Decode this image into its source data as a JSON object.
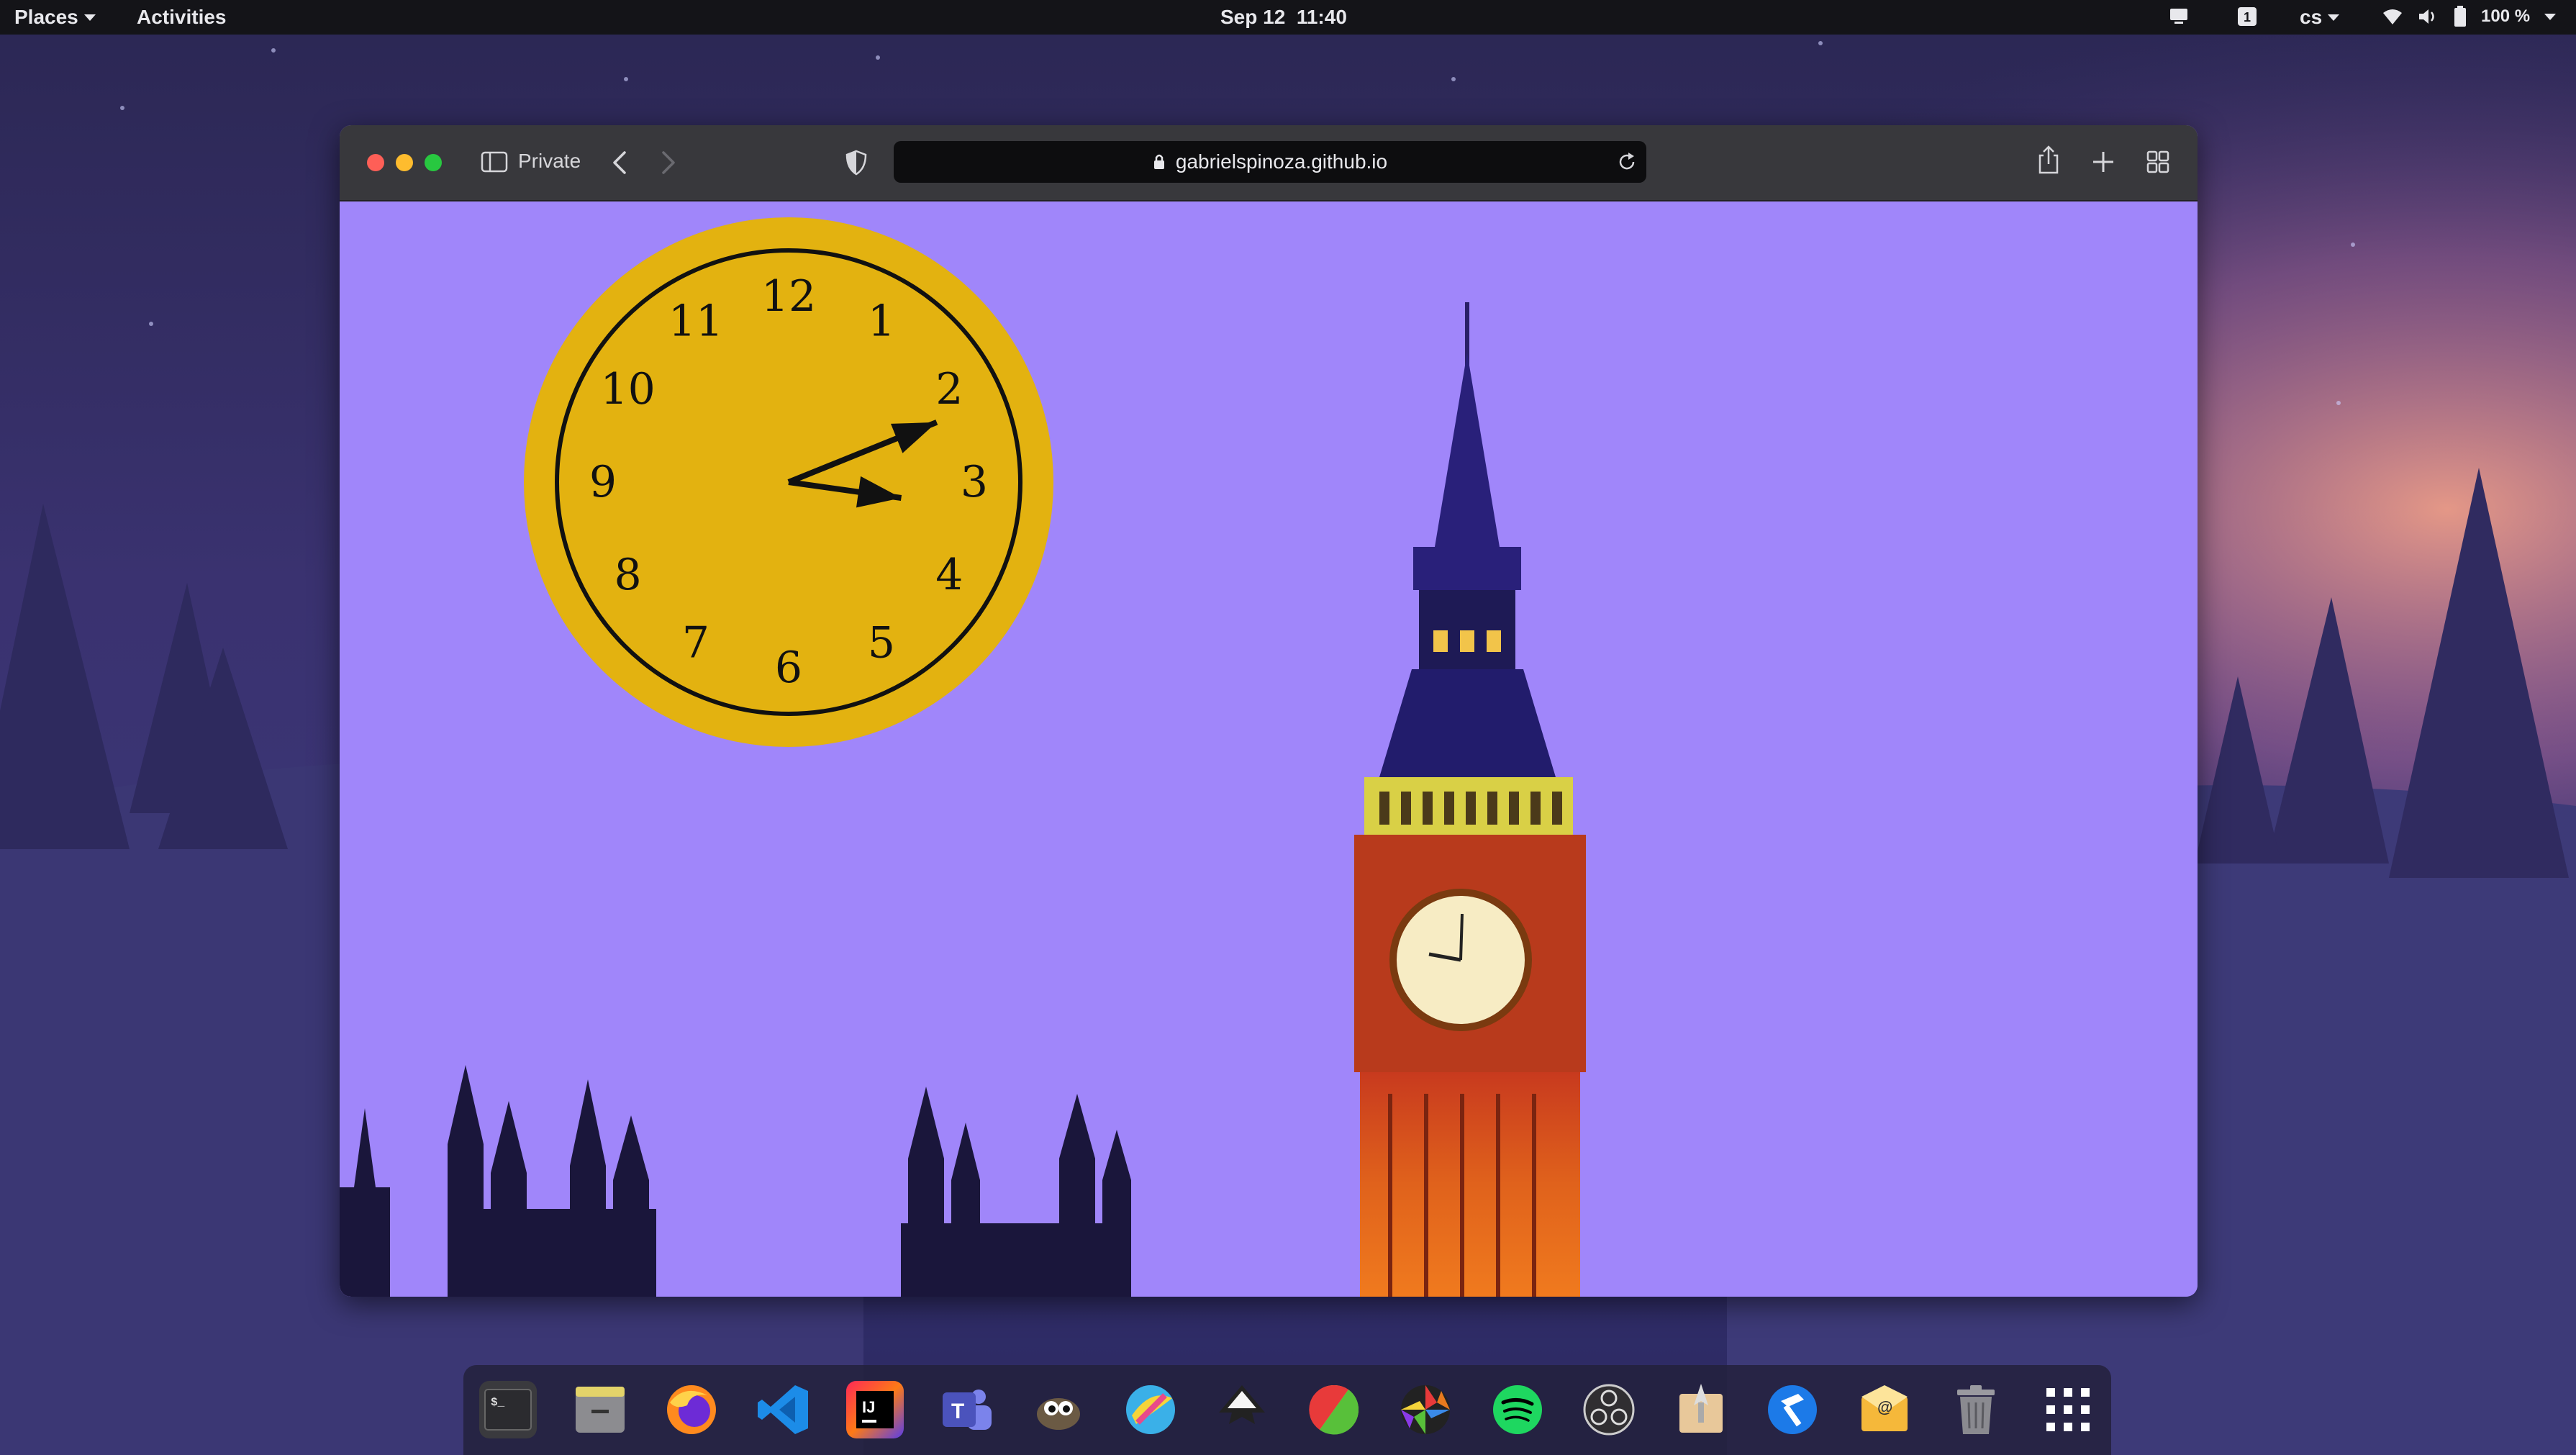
{
  "topbar": {
    "places_label": "Places",
    "activities_label": "Activities",
    "datetime": "Sep 12  11:40",
    "lang": "cs",
    "battery": "100 %"
  },
  "browser": {
    "mode_label": "Private",
    "url": "gabrielspinoza.github.io"
  },
  "clock": {
    "numbers": [
      "12",
      "1",
      "2",
      "3",
      "4",
      "5",
      "6",
      "7",
      "8",
      "9",
      "10",
      "11"
    ],
    "face_color": "#e3b210",
    "hour_hand_deg": 98,
    "minute_hand_deg": 68
  },
  "dock": {
    "items": [
      {
        "name": "terminal-icon"
      },
      {
        "name": "files-icon"
      },
      {
        "name": "firefox-icon"
      },
      {
        "name": "vscode-icon"
      },
      {
        "name": "intellij-icon",
        "text": "IJ"
      },
      {
        "name": "teams-icon",
        "text": "T"
      },
      {
        "name": "gimp-icon"
      },
      {
        "name": "krita-icon"
      },
      {
        "name": "inkscape-icon"
      },
      {
        "name": "color-picker-icon"
      },
      {
        "name": "aperture-icon"
      },
      {
        "name": "spotify-icon"
      },
      {
        "name": "obs-icon"
      },
      {
        "name": "launcher-icon"
      },
      {
        "name": "build-tool-icon"
      },
      {
        "name": "mail-icon",
        "text": "@"
      },
      {
        "name": "trash-icon"
      },
      {
        "name": "app-grid-icon"
      }
    ]
  },
  "colors": {
    "accent": "#e3b210",
    "sky": "#a086fa",
    "wallpaper": "#3a3270"
  }
}
